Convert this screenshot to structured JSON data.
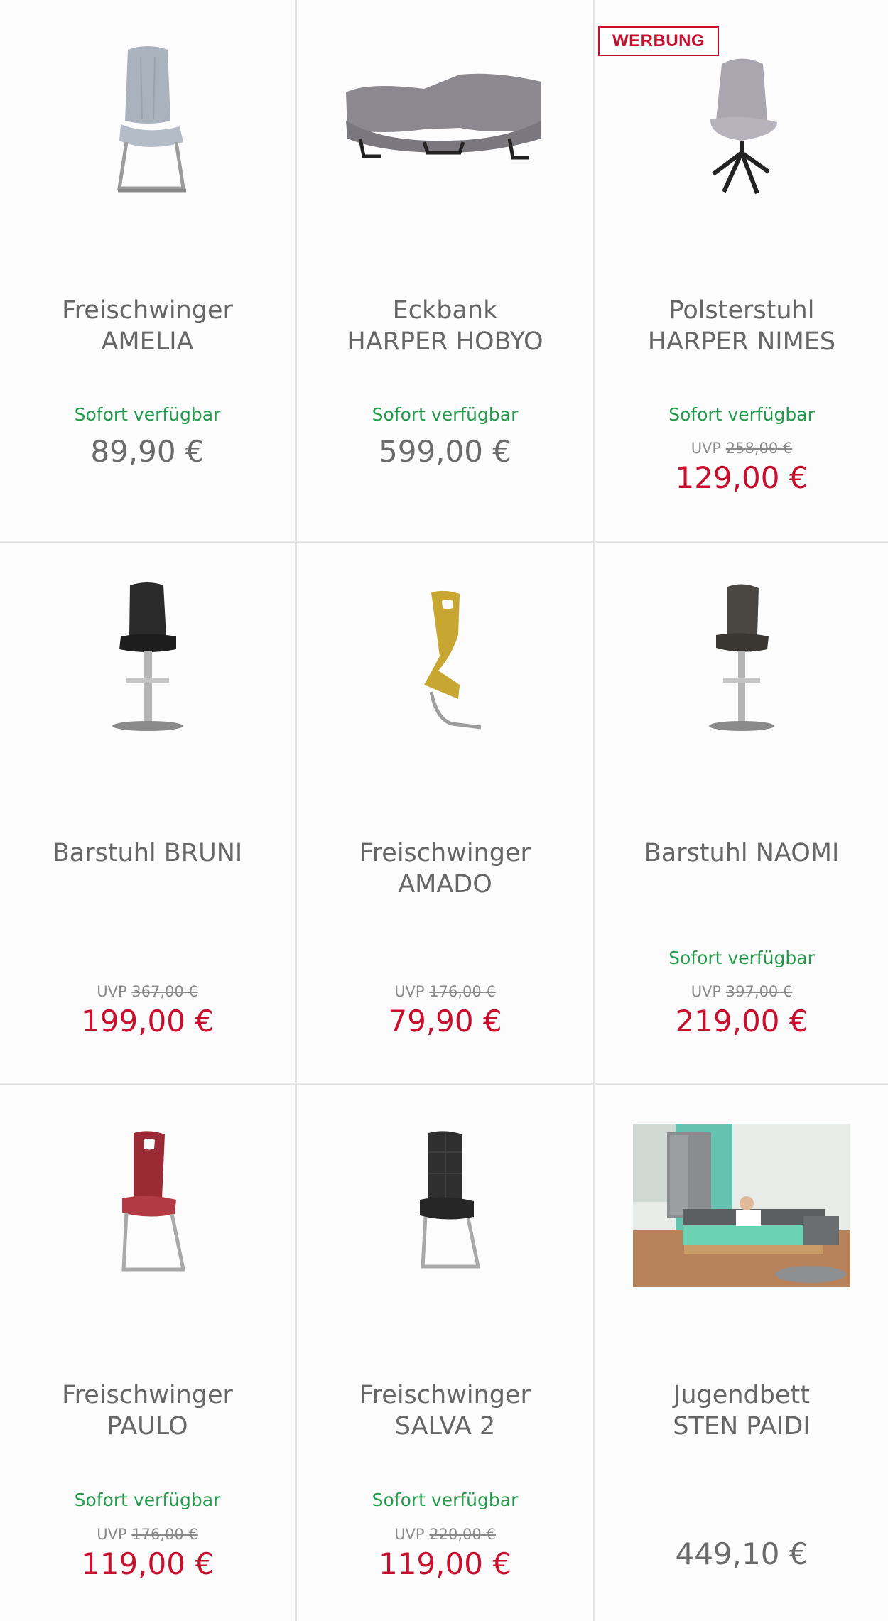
{
  "colors": {
    "availability": "#23994a",
    "sale_price": "#c8102e",
    "regular_price": "#6b6b6b",
    "title": "#666666",
    "divider": "#e3e3e3",
    "badge": "#c8102e"
  },
  "products": [
    {
      "line1": "Freischwinger",
      "line2": "AMELIA",
      "availability": "Sofort verfügbar",
      "uvp_label": "",
      "uvp_price": "",
      "price": "89,90 €",
      "badge": ""
    },
    {
      "line1": "Eckbank",
      "line2": "HARPER HOBYO",
      "availability": "Sofort verfügbar",
      "uvp_label": "",
      "uvp_price": "",
      "price": "599,00 €",
      "badge": ""
    },
    {
      "line1": "Polsterstuhl",
      "line2": "HARPER NIMES",
      "availability": "Sofort verfügbar",
      "uvp_label": "UVP",
      "uvp_price": "258,00 €",
      "price": "129,00 €",
      "badge": "WERBUNG"
    },
    {
      "line1": "Barstuhl BRUNI",
      "line2": "",
      "availability": "",
      "uvp_label": "UVP",
      "uvp_price": "367,00 €",
      "price": "199,00 €",
      "badge": ""
    },
    {
      "line1": "Freischwinger",
      "line2": "AMADO",
      "availability": "",
      "uvp_label": "UVP",
      "uvp_price": "176,00 €",
      "price": "79,90 €",
      "badge": ""
    },
    {
      "line1": "Barstuhl NAOMI",
      "line2": "",
      "availability": "Sofort verfügbar",
      "uvp_label": "UVP",
      "uvp_price": "397,00 €",
      "price": "219,00 €",
      "badge": ""
    },
    {
      "line1": "Freischwinger",
      "line2": "PAULO",
      "availability": "Sofort verfügbar",
      "uvp_label": "UVP",
      "uvp_price": "176,00 €",
      "price": "119,00 €",
      "badge": ""
    },
    {
      "line1": "Freischwinger",
      "line2": "SALVA 2",
      "availability": "Sofort verfügbar",
      "uvp_label": "UVP",
      "uvp_price": "220,00 €",
      "price": "119,00 €",
      "badge": ""
    },
    {
      "line1": "Jugendbett",
      "line2": "STEN PAIDI",
      "availability": "",
      "uvp_label": "",
      "uvp_price": "",
      "price": "449,10 €",
      "badge": ""
    }
  ]
}
